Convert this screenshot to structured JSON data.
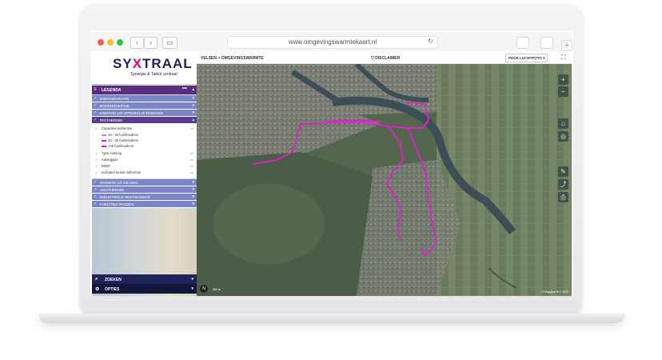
{
  "browser": {
    "url": "www.omgevingswarmtekaart.nl",
    "reload_icon": "reload-icon",
    "traffic_lights": [
      "#ff5f57",
      "#febc2e",
      "#28c840"
    ]
  },
  "brand": {
    "logo_left": "SY",
    "logo_x": "X",
    "logo_right": "TRAAL",
    "tagline": "Synergie & Talent centraal",
    "primary": "#20225a",
    "accent": "#e6007e",
    "legend_purple": "#5b2d7e",
    "layer_blue": "#7b86c8"
  },
  "header": {
    "breadcrumb": "VELSEN  >  OMGEVINGSWARMTE",
    "disclaimer": "DISCLAIMER",
    "basemap": "PDOK LUCHTFOTO",
    "basemap_arrow": "▾"
  },
  "legend": {
    "title": "LEGENDA",
    "menu_icon": "≡",
    "dots": "•••",
    "collapse": "▴",
    "layers": [
      {
        "label": "ENERGIEVRAAG",
        "arrow": "▾",
        "check": "✓"
      },
      {
        "label": "BODEMENERGIE",
        "arrow": "▾",
        "check": "✓"
      },
      {
        "label": "ENERGIE UIT OPPERVLAKTEWATER",
        "arrow": "▾",
        "check": "✓"
      },
      {
        "label": "RIOTHERMIE",
        "arrow": "▴",
        "check": "✓"
      }
    ],
    "sublayers": [
      {
        "label": "Capaciteit riothermie",
        "dots": "•••"
      },
      {
        "label": "10 - 20 huishoudens",
        "color": "#d67fc9"
      },
      {
        "label": "20 - 30 huishoudens",
        "color": "#c02aa8"
      },
      {
        "label": ">40 huishoudens",
        "color": "#e020d0"
      },
      {
        "label": "Type riolering",
        "dots": "•••"
      },
      {
        "label": "Aanlegjaar",
        "dots": "•••"
      },
      {
        "label": "RWZI",
        "dots": "•••"
      },
      {
        "label": "Indicatief bereik riothermie",
        "dots": "•••"
      }
    ],
    "layers_after": [
      {
        "label": "WARMTE UIT DE WEG",
        "arrow": "▾",
        "check": "✓"
      },
      {
        "label": "GEOTHERMIE",
        "arrow": "▾",
        "check": "✓"
      },
      {
        "label": "INDUSTRIËLE RESTWARMTE",
        "arrow": "▾",
        "check": "✓"
      },
      {
        "label": "FUNCTIES PANDEN",
        "arrow": "▾",
        "check": "✓"
      }
    ]
  },
  "bottom": {
    "search_label": "ZOEKEN",
    "options_label": "OPTIES"
  },
  "map": {
    "attribution": "© Mapgear B.V. 2020",
    "scale": "500 m",
    "zoom_in": "+",
    "zoom_out": "−",
    "route_color": "#e020d0"
  }
}
